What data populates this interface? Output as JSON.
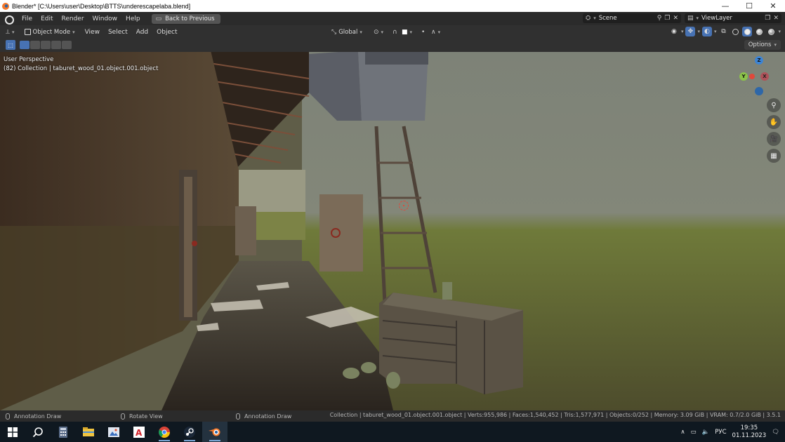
{
  "window": {
    "title": "Blender* [C:\\Users\\user\\Desktop\\BTTS\\underescapelaba.blend]",
    "minimize": "—",
    "maximize": "☐",
    "close": "✕"
  },
  "topbar": {
    "menus": [
      "File",
      "Edit",
      "Render",
      "Window",
      "Help"
    ],
    "back_button": "Back to Previous",
    "scene_label": "Scene",
    "viewlayer_label": "ViewLayer"
  },
  "viewport_header": {
    "mode": "Object Mode",
    "menus": [
      "View",
      "Select",
      "Add",
      "Object"
    ],
    "transform_orientation": "Global"
  },
  "tool_row": {
    "options_label": "Options"
  },
  "viewport": {
    "perspective": "User Perspective",
    "collection_info": "(82) Collection | taburet_wood_01.object.001.object",
    "gizmo_axes": {
      "x": "X",
      "y": "Y",
      "z": "Z"
    }
  },
  "statusbar": {
    "hint_left": "Annotation Draw",
    "hint_middle": "Rotate View",
    "hint_right": "Annotation Draw",
    "stats": "Collection | taburet_wood_01.object.001.object | Verts:955,986 | Faces:1,540,452 | Tris:1,577,971 | Objects:0/252 | Memory: 3.09 GiB | VRAM: 0.7/2.0 GiB | 3.5.1"
  },
  "taskbar": {
    "apps": [
      "start-icon",
      "search-icon",
      "calculator-icon",
      "file-explorer-icon",
      "image-viewer-icon",
      "autocad-icon",
      "chrome-icon",
      "steam-icon",
      "blender-icon"
    ],
    "language": "РУС",
    "time": "19:35",
    "date": "01.11.2023"
  },
  "colors": {
    "accent": "#4772b3",
    "axis_x": "#e0483b",
    "axis_y": "#8bc34a",
    "axis_z": "#3d84d4"
  }
}
